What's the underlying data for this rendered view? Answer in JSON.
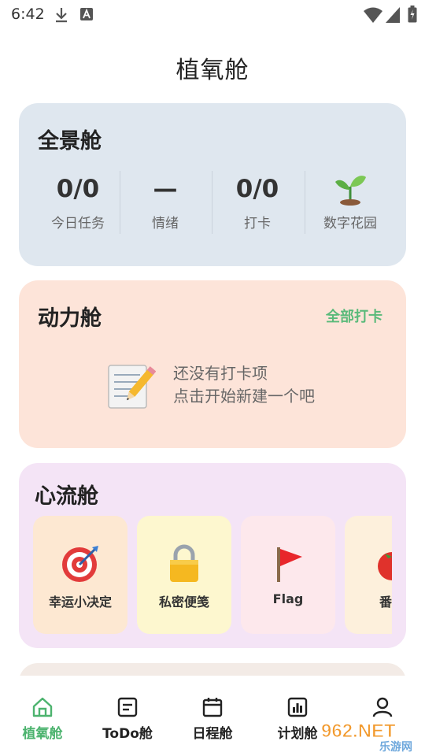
{
  "status_bar": {
    "time": "6:42"
  },
  "page_title": "植氧舱",
  "overview": {
    "title": "全景舱",
    "stats": [
      {
        "value": "0/0",
        "label": "今日任务"
      },
      {
        "value": "—",
        "label": "情绪"
      },
      {
        "value": "0/0",
        "label": "打卡"
      },
      {
        "value": "",
        "label": "数字花园",
        "icon": "seedling-icon"
      }
    ]
  },
  "motivation": {
    "title": "动力舱",
    "action": "全部打卡",
    "empty_line1": "还没有打卡项",
    "empty_line2": "点击开始新建一个吧",
    "empty_icon": "memo-icon"
  },
  "flow": {
    "title": "心流舱",
    "tiles": [
      {
        "label": "幸运小决定",
        "icon": "target-icon",
        "bg": "#fde8d2"
      },
      {
        "label": "私密便笺",
        "icon": "lock-icon",
        "bg": "#fdf7cf"
      },
      {
        "label": "Flag",
        "icon": "flag-icon",
        "bg": "#fde8ec"
      },
      {
        "label": "番茄",
        "icon": "tomato-icon",
        "bg": "#fdf0dc"
      }
    ]
  },
  "bottom_nav": {
    "active_color": "#4cb36e",
    "items": [
      {
        "label": "植氧舱",
        "icon": "home-icon",
        "active": true
      },
      {
        "label": "ToDo舱",
        "icon": "todo-icon",
        "active": false
      },
      {
        "label": "日程舱",
        "icon": "calendar-icon",
        "active": false
      },
      {
        "label": "计划舱",
        "icon": "chart-icon",
        "active": false
      },
      {
        "label": "",
        "icon": "person-icon",
        "active": false
      }
    ]
  },
  "watermark": {
    "text": "962.NET",
    "subtext": "乐游网"
  }
}
